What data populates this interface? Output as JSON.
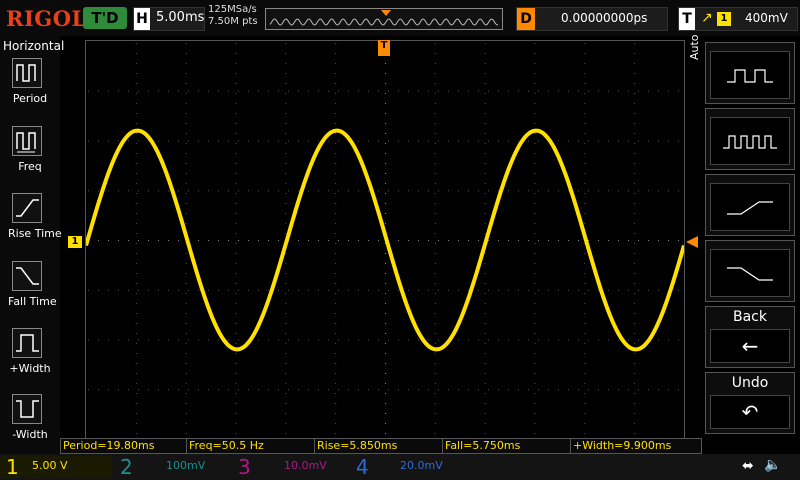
{
  "brand": "RIGOL",
  "status": "T'D",
  "horizontal": {
    "label": "H",
    "value": "5.00ms"
  },
  "sample": {
    "rate": "125MSa/s",
    "points": "7.50M pts"
  },
  "delay": {
    "label": "D",
    "value": "0.00000000ps"
  },
  "trigger": {
    "label": "T",
    "edge": "↗",
    "channel": "1",
    "level": "400mV"
  },
  "left_menu": {
    "title": "Horizontal",
    "items": [
      {
        "label": "Period"
      },
      {
        "label": "Freq"
      },
      {
        "label": "Rise Time"
      },
      {
        "label": "Fall Time"
      },
      {
        "label": "+Width"
      },
      {
        "label": "-Width"
      }
    ]
  },
  "markers": {
    "channel": "1",
    "trigger": "T"
  },
  "right_menu": {
    "auto": "Auto",
    "back": "Back",
    "undo": "Undo"
  },
  "measurements": [
    "Period=19.80ms",
    "Freq=50.5 Hz",
    "Rise=5.850ms",
    "Fall=5.750ms",
    "+Width=9.900ms"
  ],
  "channels": [
    {
      "num": "1",
      "scale": "5.00 V",
      "color": "#ffe000"
    },
    {
      "num": "2",
      "scale": "100mV",
      "color": "#1b8f8f"
    },
    {
      "num": "3",
      "scale": "10.0mV",
      "color": "#b0168a"
    },
    {
      "num": "4",
      "scale": "20.0mV",
      "color": "#2d6ad6"
    }
  ],
  "waveform": {
    "color": "#ffe000",
    "periods": 3,
    "amplitude_divisions": 2.2
  }
}
